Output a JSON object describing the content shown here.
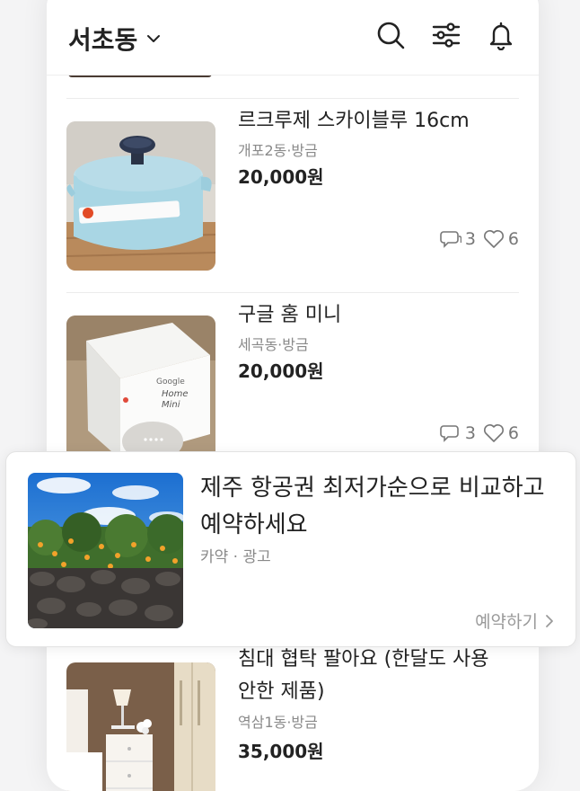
{
  "header": {
    "location": "서초동",
    "icons": [
      "search-icon",
      "filter-icon",
      "bell-icon"
    ]
  },
  "items": [
    {
      "title": "르크루제 스카이블루 16cm",
      "location": "개포2동",
      "time": "방금",
      "meta": "개포2동·방금",
      "price": "20,000원",
      "comments": "3",
      "likes": "6"
    },
    {
      "title": "구글 홈 미니",
      "location": "세곡동",
      "time": "방금",
      "meta": "세곡동·방금",
      "price": "20,000원",
      "comments": "3",
      "likes": "6"
    },
    {
      "title": "침대 협탁 팔아요 (한달도 사용 안한 제품)",
      "title_line1": "침대 협탁 팔아요 (한달도 사용",
      "title_line2": "안한 제품)",
      "location": "역삼1동",
      "time": "방금",
      "meta": "역삼1동·방금",
      "price": "35,000원"
    }
  ],
  "ad": {
    "title_line1": "제주 항공권 최저가순으로 비교하고",
    "title_line2": "예약하세요",
    "meta": "카약 · 광고",
    "cta": "예약하기"
  },
  "colors": {
    "text": "#222222",
    "muted": "#8a8a8a",
    "pot_blue": "#a9d6e4",
    "sky": "#2f7fd6"
  }
}
